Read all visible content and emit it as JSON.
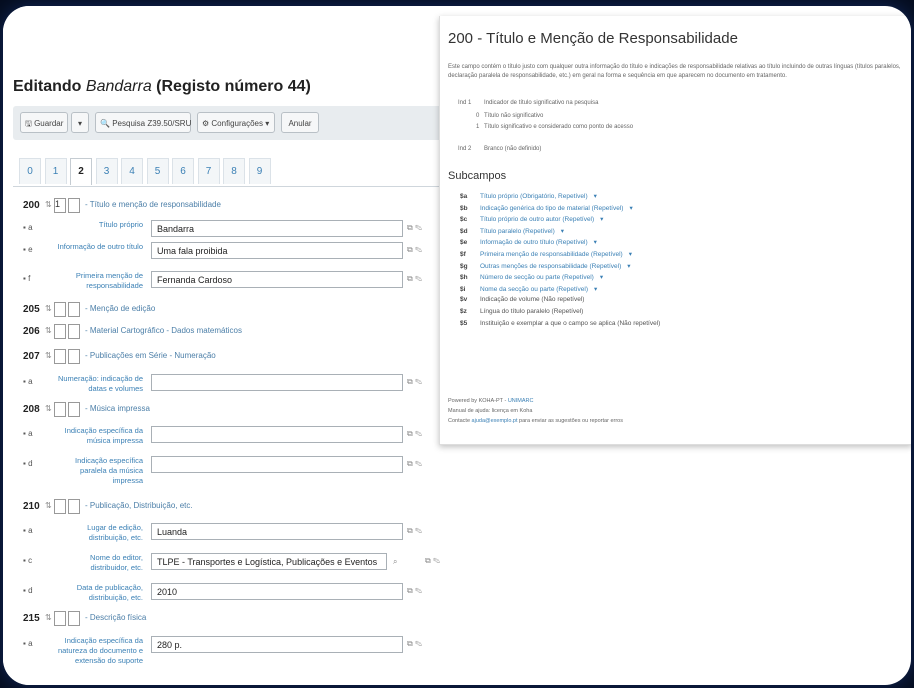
{
  "editor": {
    "title_prefix": "Editando",
    "title_name": "Bandarra",
    "title_suffix": "(Registo número 44)",
    "toolbar": {
      "save": "Guardar",
      "save_caret": "▾",
      "search": "Pesquisa Z39.50/SRU",
      "settings": "Configurações",
      "cancel": "Anular"
    },
    "tabs": [
      "0",
      "1",
      "2",
      "3",
      "4",
      "5",
      "6",
      "7",
      "8",
      "9"
    ],
    "active_tab": "2",
    "fields": [
      {
        "tag": "200",
        "ind1": "1",
        "ind2": "",
        "title": "- Título e menção de responsabilidade",
        "subs": [
          {
            "code": "a",
            "label": "Título próprio",
            "value": "Bandarra"
          },
          {
            "code": "e",
            "label": "Informação de outro título",
            "value": "Uma fala proibida"
          },
          {
            "code": "f",
            "label": "Primeira menção de responsabilidade",
            "value": "Fernanda Cardoso"
          }
        ]
      },
      {
        "tag": "205",
        "ind1": "",
        "ind2": "",
        "title": "- Menção de edição",
        "subs": []
      },
      {
        "tag": "206",
        "ind1": "",
        "ind2": "",
        "title": "- Material Cartográfico - Dados matemáticos",
        "subs": []
      },
      {
        "tag": "207",
        "ind1": "",
        "ind2": "",
        "title": "- Publicações em Série - Numeração",
        "subs": [
          {
            "code": "a",
            "label": "Numeração: indicação de datas e volumes",
            "value": ""
          }
        ]
      },
      {
        "tag": "208",
        "ind1": "",
        "ind2": "",
        "title": "- Música impressa",
        "subs": [
          {
            "code": "a",
            "label": "Indicação específica da música impressa",
            "value": ""
          },
          {
            "code": "d",
            "label": "Indicação específica paralela da música impressa",
            "value": ""
          }
        ]
      },
      {
        "tag": "210",
        "ind1": "",
        "ind2": "",
        "title": "- Publicação, Distribuição, etc.",
        "subs": [
          {
            "code": "a",
            "label": "Lugar de edição, distribuição, etc.",
            "value": "Luanda"
          },
          {
            "code": "c",
            "label": "Nome do editor, distribuidor, etc.",
            "value": "TLPE - Transportes e Logística, Publicações e Eventos"
          },
          {
            "code": "d",
            "label": "Data de publicação, distribuição, etc.",
            "value": "2010"
          }
        ]
      },
      {
        "tag": "215",
        "ind1": "",
        "ind2": "",
        "title": "- Descrição física",
        "subs": [
          {
            "code": "a",
            "label": "Indicação específica da natureza do documento e extensão do suporte",
            "value": "280 p."
          }
        ]
      }
    ]
  },
  "help": {
    "title": "200 - Título e Menção de Responsabilidade",
    "description": "Este campo contém o título justo com qualquer outra informação do título e indicações de responsabilidade relativas ao título incluindo de outras línguas (títulos paralelos, declaração paralela de responsabilidade, etc.) em geral na forma e sequência em que aparecem no documento em tratamento.",
    "indicators": [
      {
        "code": "Ind 1",
        "text": "Indicador de título significativo na pesquisa"
      },
      {
        "code": "0",
        "text": "Título não significativo"
      },
      {
        "code": "1",
        "text": "Título significativo e considerado como ponto de acesso"
      },
      {
        "code": "Ind 2",
        "text": "Branco (não definido)"
      }
    ],
    "subfields_title": "Subcampos",
    "subfields": [
      {
        "code": "$a",
        "text": "Título próprio (Obrigatório, Repetível)",
        "link": true
      },
      {
        "code": "$b",
        "text": "Indicação genérica do tipo de material (Repetível)",
        "link": true
      },
      {
        "code": "$c",
        "text": "Título próprio de outro autor (Repetível)",
        "link": true
      },
      {
        "code": "$d",
        "text": "Título paralelo (Repetível)",
        "link": true
      },
      {
        "code": "$e",
        "text": "Informação de outro título (Repetível)",
        "link": true
      },
      {
        "code": "$f",
        "text": "Primeira menção de responsabilidade (Repetível)",
        "link": true
      },
      {
        "code": "$g",
        "text": "Outras menções de responsabilidade (Repetível)",
        "link": true
      },
      {
        "code": "$h",
        "text": "Número de secção ou parte (Repetível)",
        "link": true
      },
      {
        "code": "$i",
        "text": "Nome da secção ou parte (Repetível)",
        "link": true
      },
      {
        "code": "$v",
        "text": "Indicação de volume (Não repetível)",
        "link": false
      },
      {
        "code": "$z",
        "text": "Língua do título paralelo (Repetível)",
        "link": false
      },
      {
        "code": "$5",
        "text": "Instituição e exemplar a que o campo se aplica (Não repetível)",
        "link": false
      }
    ],
    "caret": "▾",
    "footer": [
      {
        "text": "Powered by KOHA-PT -",
        "link": "UNIMARC"
      },
      {
        "text": "Manual de ajuda: licença em Koha",
        "link": ""
      },
      {
        "text": "Contacte",
        "link": "ajuda@exemplo.pt",
        "after": "para enviar as sugestões ou reportar erros"
      }
    ]
  }
}
